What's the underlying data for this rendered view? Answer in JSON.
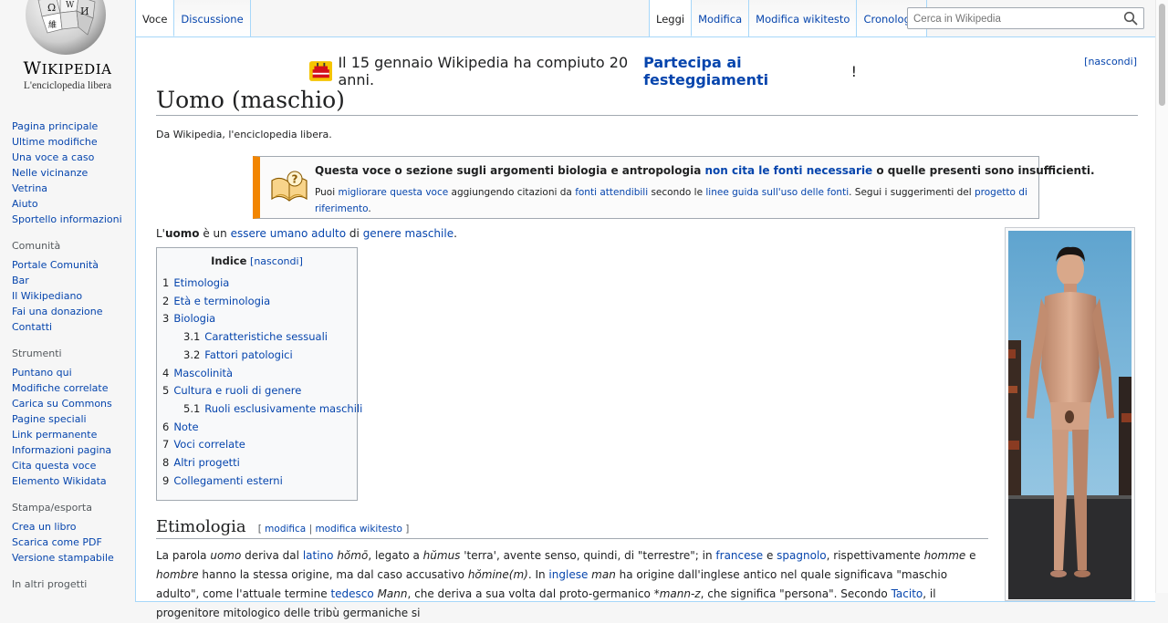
{
  "logo": {
    "wordmark_big": "W",
    "wordmark_rest": "IKIPEDIA",
    "tagline": "L'enciclopedia libera"
  },
  "sidebar": {
    "navigation": [
      "Pagina principale",
      "Ultime modifiche",
      "Una voce a caso",
      "Nelle vicinanze",
      "Vetrina",
      "Aiuto",
      "Sportello informazioni"
    ],
    "community": {
      "heading": "Comunità",
      "items": [
        "Portale Comunità",
        "Bar",
        "Il Wikipediano",
        "Fai una donazione",
        "Contatti"
      ]
    },
    "tools": {
      "heading": "Strumenti",
      "items": [
        "Puntano qui",
        "Modifiche correlate",
        "Carica su Commons",
        "Pagine speciali",
        "Link permanente",
        "Informazioni pagina",
        "Cita questa voce",
        "Elemento Wikidata"
      ]
    },
    "print": {
      "heading": "Stampa/esporta",
      "items": [
        "Crea un libro",
        "Scarica come PDF",
        "Versione stampabile"
      ]
    },
    "other_heading": "In altri progetti"
  },
  "tabs": {
    "left": [
      "Voce",
      "Discussione"
    ],
    "right": [
      "Leggi",
      "Modifica",
      "Modifica wikitesto",
      "Cronologia"
    ]
  },
  "search": {
    "placeholder": "Cerca in Wikipedia"
  },
  "notice": {
    "text": "Il 15 gennaio Wikipedia ha compiuto 20 anni.",
    "link": "Partecipa ai festeggiamenti",
    "suffix": "!",
    "hide": "[nascondi]"
  },
  "article": {
    "title": "Uomo (maschio)",
    "site_sub": "Da Wikipedia, l'enciclopedia libera."
  },
  "ambox": {
    "l1_a": "Questa voce o sezione sugli argomenti biologia e antropologia ",
    "l1_link": "non cita le fonti necessarie",
    "l1_b": " o quelle presenti sono insufficienti.",
    "l2_a": "Puoi ",
    "l2_link1": "migliorare questa voce",
    "l2_b": " aggiungendo citazioni da ",
    "l2_link2": "fonti attendibili",
    "l2_c": " secondo le ",
    "l2_link3": "linee guida sull'uso delle fonti",
    "l2_d": ". Segui i suggerimenti del ",
    "l2_link4": "progetto di riferimento",
    "l2_e": "."
  },
  "intro": {
    "a": "L'",
    "bold": "uomo",
    "b": " è un ",
    "link1": "essere umano adulto",
    "c": " di ",
    "link2": "genere maschile",
    "d": "."
  },
  "toc": {
    "title": "Indice",
    "hide": "[nascondi]",
    "items": [
      {
        "num": "1",
        "label": "Etimologia",
        "sub": false
      },
      {
        "num": "2",
        "label": "Età e terminologia",
        "sub": false
      },
      {
        "num": "3",
        "label": "Biologia",
        "sub": false
      },
      {
        "num": "3.1",
        "label": "Caratteristiche sessuali",
        "sub": true
      },
      {
        "num": "3.2",
        "label": "Fattori patologici",
        "sub": true
      },
      {
        "num": "4",
        "label": "Mascolinità",
        "sub": false
      },
      {
        "num": "5",
        "label": "Cultura e ruoli di genere",
        "sub": false
      },
      {
        "num": "5.1",
        "label": "Ruoli esclusivamente maschili",
        "sub": true
      },
      {
        "num": "6",
        "label": "Note",
        "sub": false
      },
      {
        "num": "7",
        "label": "Voci correlate",
        "sub": false
      },
      {
        "num": "8",
        "label": "Altri progetti",
        "sub": false
      },
      {
        "num": "9",
        "label": "Collegamenti esterni",
        "sub": false
      }
    ]
  },
  "section": {
    "title": "Etimologia",
    "edit_open": "[ ",
    "edit1": "modifica",
    "edit_sep": " | ",
    "edit2": "modifica wikitesto",
    "edit_close": " ]"
  },
  "para": {
    "t1": "La parola ",
    "i1": "uomo",
    "t2": " deriva dal ",
    "l1": "latino",
    "t3": " ",
    "i2": "hŏmō",
    "t4": ", legato a ",
    "i3": "hŭmus",
    "t5": " 'terra', avente senso, quindi, di \"terrestre\"; in ",
    "l2": "francese",
    "t6": " e ",
    "l3": "spagnolo",
    "t7": ", rispettivamente ",
    "i4": "homme",
    "t8": " e ",
    "i5": "hombre",
    "t9": " hanno la stessa origine, ma dal caso accusativo ",
    "i6": "hŏmine(m)",
    "t10": ". In ",
    "l4": "inglese",
    "t11": " ",
    "i7": "man",
    "t12": " ha origine dall'inglese antico nel quale significava \"maschio adulto\", come l'attuale termine ",
    "l5": "tedesco",
    "t13": " ",
    "i8": "Mann",
    "t14": ", che deriva a sua volta dal proto-germanico *",
    "i9": "mann-z",
    "t15": ", che significa \"persona\". Secondo ",
    "l6": "Tacito",
    "t16": ", il progenitore mitologico delle tribù germaniche si"
  },
  "colors": {
    "link": "#0645ad",
    "ambox_border": "#f28500",
    "tab_border": "#a7d7f9"
  }
}
